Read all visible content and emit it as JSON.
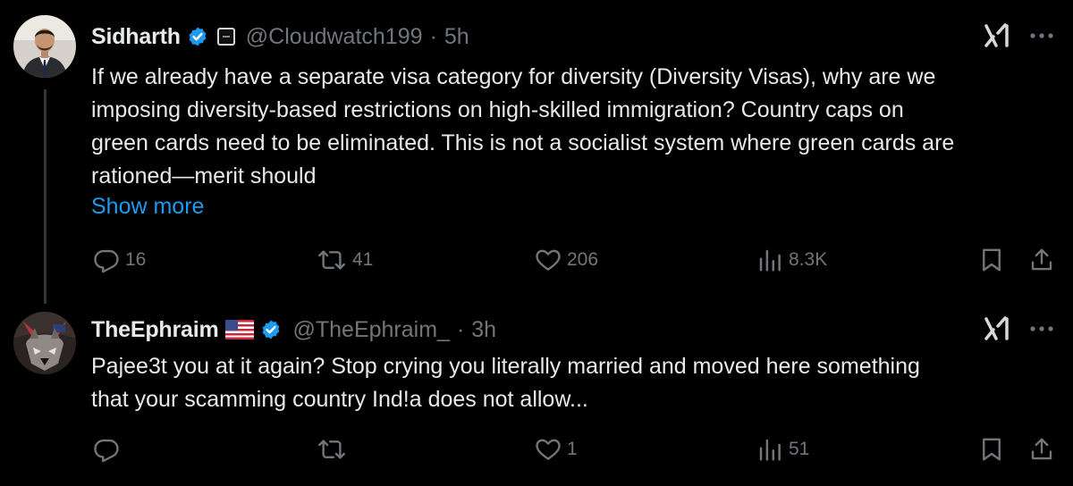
{
  "tweets": [
    {
      "name": "Sidharth",
      "handle": "@Cloudwatch199",
      "separator": "·",
      "time": "5h",
      "text_lines": [
        "If we already have a separate visa category for diversity (Diversity Visas), why are we",
        "imposing diversity-based restrictions on high-skilled immigration? Country caps on",
        "green cards need to be eliminated. This is not a socialist system where green cards are",
        "rationed—merit should"
      ],
      "show_more": "Show more",
      "actions": {
        "replies": "16",
        "reposts": "41",
        "likes": "206",
        "views": "8.3K"
      },
      "icons": [
        "avatar",
        "verified-badge-icon",
        "affiliate-badge-icon",
        "grok-icon",
        "more-icon",
        "reply-icon",
        "repost-icon",
        "like-icon",
        "views-icon",
        "bookmark-icon",
        "share-icon"
      ]
    },
    {
      "name": "TheEphraim",
      "handle": "@TheEphraim_",
      "separator": "·",
      "time": "3h",
      "text_lines": [
        "Pajee3t you at it again? Stop crying you literally married and moved here something",
        "that your scamming country Ind!a does not allow..."
      ],
      "actions": {
        "replies": "",
        "reposts": "",
        "likes": "1",
        "views": "51"
      },
      "icons": [
        "avatar",
        "us-flag-icon",
        "verified-badge-icon",
        "grok-icon",
        "more-icon",
        "reply-icon",
        "repost-icon",
        "like-icon",
        "views-icon",
        "bookmark-icon",
        "share-icon"
      ]
    }
  ],
  "colors": {
    "background": "#000000",
    "text": "#e7e9ea",
    "secondary": "#71767b",
    "link": "#1d9bf0",
    "thread_line": "#333639",
    "verified": "#1d9bf0"
  }
}
